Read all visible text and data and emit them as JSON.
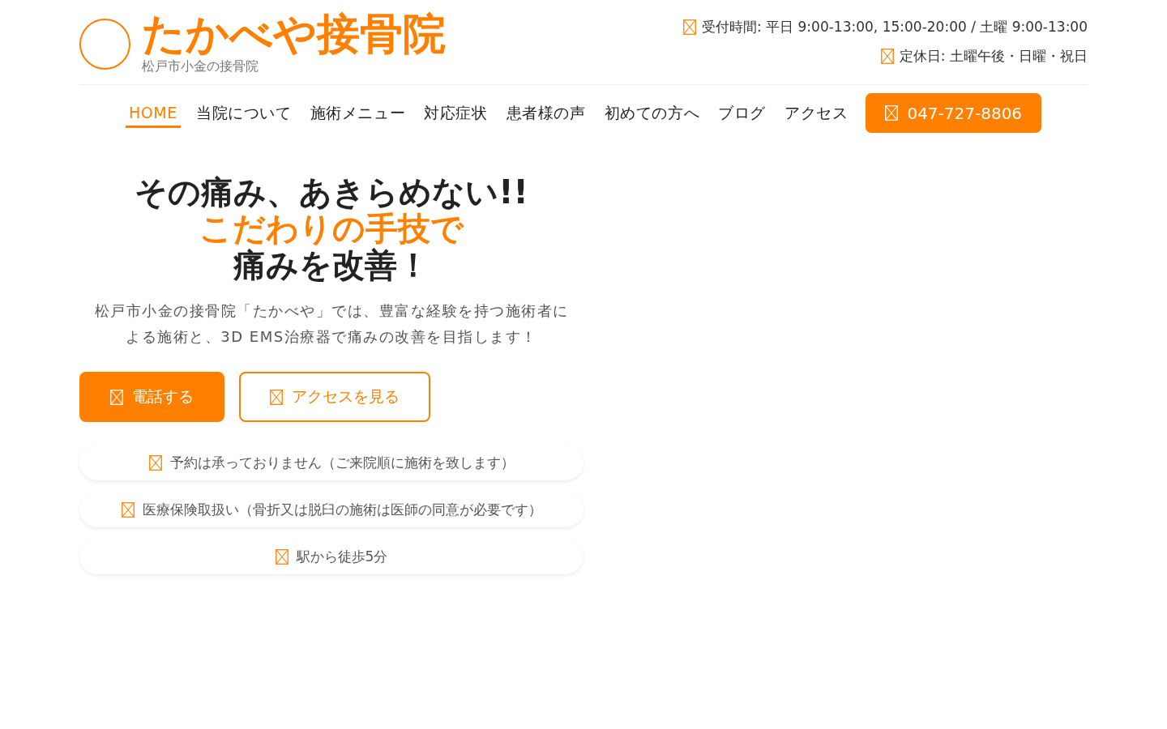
{
  "header": {
    "logo": {
      "title": "たかべや接骨院",
      "subtitle": "松戸市小金の接骨院"
    },
    "info": [
      "受付時間: 平日 9:00-13:00, 15:00-20:00 / 土曜 9:00-13:00",
      "定休日: 土曜午後・日曜・祝日"
    ]
  },
  "nav": {
    "items": [
      {
        "label": "HOME",
        "selected": true
      },
      {
        "label": "当院について",
        "selected": false
      },
      {
        "label": "施術メニュー",
        "selected": false
      },
      {
        "label": "対応症状",
        "selected": false
      },
      {
        "label": "患者様の声",
        "selected": false
      },
      {
        "label": "初めての方へ",
        "selected": false
      },
      {
        "label": "ブログ",
        "selected": false
      },
      {
        "label": "アクセス",
        "selected": false
      }
    ],
    "phone_button": "047-727-8806"
  },
  "hero": {
    "headline": [
      {
        "text": "その痛み、あきらめない!!",
        "accent": false
      },
      {
        "text": "こだわりの手技で",
        "accent": true
      },
      {
        "text": "痛みを改善！",
        "accent": false
      }
    ],
    "lead": "松戸市小金の接骨院「たかべや」では、豊富な経験を持つ施術者による施術と、3D EMS治療器で痛みの改善を目指します！",
    "buttons": [
      {
        "label": "電話する",
        "kind": "filled"
      },
      {
        "label": "アクセスを見る",
        "kind": "outline"
      }
    ],
    "features": [
      "予約は承っておりません（ご来院順に施術を致します）",
      "医療保険取扱い（骨折又は脱臼の施術は医師の同意が必要です）",
      "駅から徒歩5分"
    ]
  }
}
